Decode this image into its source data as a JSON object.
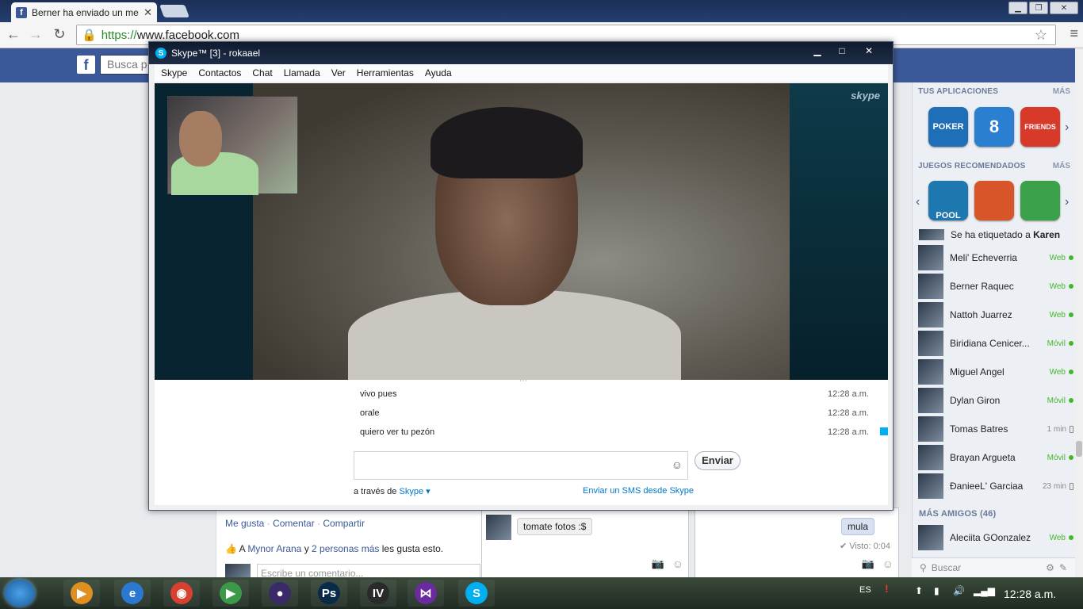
{
  "browser": {
    "tab_title": "Berner ha enviado un mer",
    "url_scheme": "https://",
    "url_host": "www.facebook.com"
  },
  "facebook": {
    "logo": "f",
    "search_placeholder": "Busca p",
    "post_actions": {
      "like": "Me gusta",
      "comment": "Comentar",
      "share": "Compartir",
      "sep": " · "
    },
    "likes_line": {
      "prefix": "A ",
      "name": "Mynor Arana",
      "mid": " y ",
      "others": "2 personas más",
      "suffix": " les gusta esto."
    },
    "comment_placeholder": "Escribe un comentario...",
    "chat1_message": "tomate fotos :$",
    "chat2_message": "mula",
    "chat2_seen": "✔ Visto: 0:04"
  },
  "sidebar": {
    "apps_title": "TUS APLICACIONES",
    "apps_more": "MÁS",
    "apps": [
      {
        "label": "POKER",
        "color": "#1f6fb8"
      },
      {
        "label": "8",
        "color": "#2a7fd0"
      },
      {
        "label": "FRIENDS",
        "color": "#d83a2a"
      }
    ],
    "games_title": "JUEGOS RECOMENDADOS",
    "games_more": "MÁS",
    "games": [
      {
        "label": "POOL",
        "color": "#1e78b0"
      },
      {
        "label": "",
        "color": "#d8552a"
      },
      {
        "label": "",
        "color": "#3aa04a"
      }
    ],
    "tag_notice": {
      "prefix": "Se ha etiquetado a ",
      "name": "Karen"
    },
    "friends": [
      {
        "name": "Meli' Echeverria",
        "status": "Web",
        "type": "web"
      },
      {
        "name": "Berner Raquec",
        "status": "Web",
        "type": "web"
      },
      {
        "name": "Nattoh Juarrez",
        "status": "Web",
        "type": "web"
      },
      {
        "name": "Biridiana Cenicer...",
        "status": "Móvil",
        "type": "web"
      },
      {
        "name": "Miguel Angel",
        "status": "Web",
        "type": "web"
      },
      {
        "name": "Dylan Giron",
        "status": "Móvil",
        "type": "web"
      },
      {
        "name": "Tomas Batres",
        "status": "1 min",
        "type": "idle"
      },
      {
        "name": "Brayan Argueta",
        "status": "Móvil",
        "type": "web"
      },
      {
        "name": "ĐanieeL' Garciaa",
        "status": "23 min",
        "type": "idle"
      }
    ],
    "more_friends": "MÁS AMIGOS (46)",
    "more_friend": {
      "name": "Aleciita GOonzalez",
      "status": "Web"
    },
    "search_placeholder": "Buscar"
  },
  "skype": {
    "title": "Skype™ [3] - rokaael",
    "menu": [
      "Skype",
      "Contactos",
      "Chat",
      "Llamada",
      "Ver",
      "Herramientas",
      "Ayuda"
    ],
    "watermark": "skype",
    "messages": [
      {
        "text": "vivo pues",
        "time": "12:28 a.m."
      },
      {
        "text": "orale",
        "time": "12:28 a.m."
      },
      {
        "text": "quiero ver tu pezón",
        "time": "12:28 a.m."
      }
    ],
    "send_label": "Enviar",
    "via_prefix": "a través de ",
    "via_link": "Skype",
    "sms_link": "Enviar un SMS desde Skype"
  },
  "taskbar": {
    "language": "ES",
    "clock": "12:28 a.m.",
    "apps": [
      {
        "name": "media-player-icon",
        "label": "▶",
        "color": "#e09020"
      },
      {
        "name": "internet-explorer-icon",
        "label": "e",
        "color": "#2a78d0"
      },
      {
        "name": "chrome-icon",
        "label": "◉",
        "color": "#d84030"
      },
      {
        "name": "media-center-icon",
        "label": "▶",
        "color": "#3a9a4a"
      },
      {
        "name": "eclipse-icon",
        "label": "●",
        "color": "#3a2a6a"
      },
      {
        "name": "photoshop-icon",
        "label": "Ps",
        "color": "#0a2a4a"
      },
      {
        "name": "iv-icon",
        "label": "IV",
        "color": "#2a2a2a"
      },
      {
        "name": "visual-studio-icon",
        "label": "⋈",
        "color": "#6a2aa0"
      },
      {
        "name": "skype-taskbar-icon",
        "label": "S",
        "color": "#00aff0"
      }
    ]
  }
}
